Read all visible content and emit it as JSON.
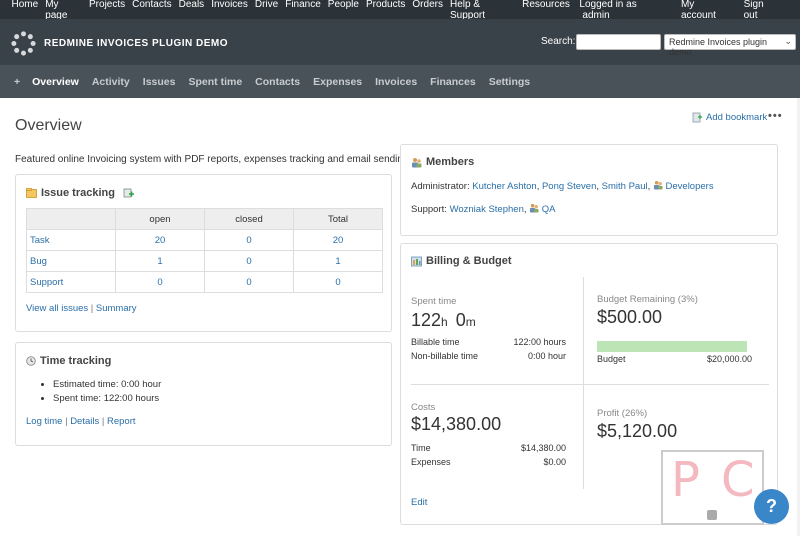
{
  "top_menu": {
    "items": [
      "Home",
      "My page",
      "Projects",
      "Contacts",
      "Deals",
      "Invoices",
      "Drive",
      "Finance",
      "People",
      "Products",
      "Orders",
      "Help & Support",
      "Resources"
    ],
    "logged_in_prefix": "Logged in as",
    "user": "admin",
    "my_account": "My account",
    "sign_out": "Sign out"
  },
  "header": {
    "title": "REDMINE INVOICES PLUGIN DEMO",
    "search_label": "Search:",
    "search_value": "",
    "project_selected": "Redmine Invoices plugin demo"
  },
  "main_menu": {
    "plus": "+",
    "tabs": [
      "Overview",
      "Activity",
      "Issues",
      "Spent time",
      "Contacts",
      "Expenses",
      "Invoices",
      "Finances",
      "Settings"
    ],
    "active": "Overview"
  },
  "page": {
    "title": "Overview",
    "add_bookmark": "Add bookmark",
    "more": "•••",
    "description": "Featured online Invoicing system with PDF reports, expenses tracking and email sending"
  },
  "issue_tracking": {
    "title": "Issue tracking",
    "columns": [
      "",
      "open",
      "closed",
      "Total"
    ],
    "rows": [
      {
        "name": "Task",
        "open": "20",
        "closed": "0",
        "total": "20"
      },
      {
        "name": "Bug",
        "open": "1",
        "closed": "0",
        "total": "1"
      },
      {
        "name": "Support",
        "open": "0",
        "closed": "0",
        "total": "0"
      }
    ],
    "view_all": "View all issues",
    "separator": "|",
    "summary": "Summary"
  },
  "time_tracking": {
    "title": "Time tracking",
    "estimated": "Estimated time: 0:00 hour",
    "spent": "Spent time: 122:00 hours",
    "log_time": "Log time",
    "details": "Details",
    "report": "Report",
    "separator": "|"
  },
  "members": {
    "title": "Members",
    "administrator_label": "Administrator:",
    "administrators": [
      "Kutcher Ashton",
      "Pong Steven",
      "Smith Paul"
    ],
    "admin_group": "Developers",
    "support_label": "Support:",
    "support_member": "Wozniak Stephen",
    "support_group": "QA",
    "comma": ","
  },
  "billing": {
    "title": "Billing & Budget",
    "spent_time_label": "Spent time",
    "spent_hours": "122",
    "spent_h_unit": "h",
    "spent_minutes": "0",
    "spent_m_unit": "m",
    "billable_label": "Billable time",
    "billable_value": "122:00 hours",
    "nonbillable_label": "Non-billable time",
    "nonbillable_value": "0:00 hour",
    "budget_remaining_label": "Budget Remaining (3%)",
    "budget_remaining_value": "$500.00",
    "budget_remaining_fraction": 0.97,
    "budget_label": "Budget",
    "budget_value": "$20,000.00",
    "costs_label": "Costs",
    "costs_value": "$14,380.00",
    "time_label": "Time",
    "time_value": "$14,380.00",
    "expenses_label": "Expenses",
    "expenses_value": "$0.00",
    "profit_label": "Profit (26%)",
    "profit_value": "$5,120.00",
    "edit": "Edit"
  },
  "watermark": {
    "left": "P",
    "right": "C"
  },
  "help": {
    "label": "?"
  },
  "colors": {
    "top_bar": "#2c3338",
    "header": "#3a4249",
    "menu": "#4a5259",
    "link": "#2a6fa8",
    "budget_bar": "#bde4b5",
    "help_button": "#3987c9"
  }
}
